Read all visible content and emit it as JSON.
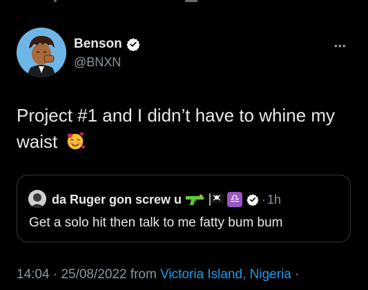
{
  "author": {
    "display_name": "Benson",
    "handle": "@BNXN",
    "verified_icon": "verified-badge-icon"
  },
  "tweet": {
    "text": "Project #1 and I didn’t have to whine my waist",
    "emoji": "smiling-face-with-hearts"
  },
  "quote": {
    "display_name": "da Ruger gon screw u",
    "name_emojis": [
      "water-pistol",
      "pirate-flag",
      "libra"
    ],
    "libra_glyph": "♎",
    "separator": "·",
    "time": "1h",
    "text": "Get a solo hit then talk to me fatty bum bum"
  },
  "meta": {
    "time": "14:04",
    "sep1": " · ",
    "date": "25/08/2022",
    "from": " from ",
    "location": "Victoria Island, Nigeria",
    "sep2": " ·"
  },
  "colors": {
    "background": "#000000",
    "primary_text": "#e7e9ea",
    "secondary_text": "#8b98a5",
    "link": "#1d9bf0",
    "border": "#333639",
    "verified": "#ffffff"
  }
}
